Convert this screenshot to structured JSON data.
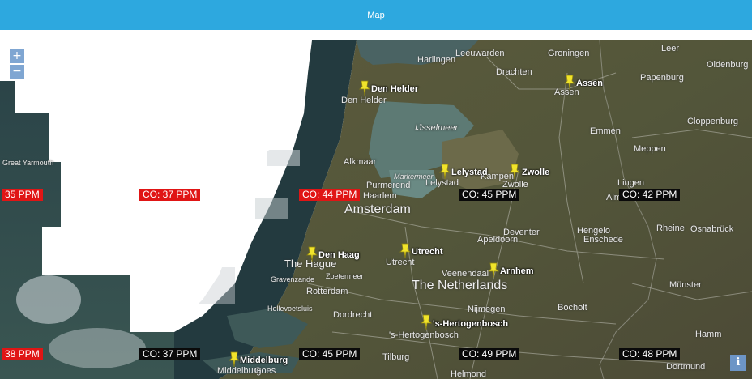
{
  "header": {
    "title": "Map"
  },
  "controls": {
    "zoom_in": "+",
    "zoom_out": "−",
    "info": "i"
  },
  "co_badges": [
    {
      "text": "35 PPM",
      "color": "red"
    },
    {
      "text": "CO: 37 PPM",
      "color": "red"
    },
    {
      "text": "CO: 44 PPM",
      "color": "red"
    },
    {
      "text": "CO: 45 PPM",
      "color": "black"
    },
    {
      "text": "CO: 42 PPM",
      "color": "black"
    },
    {
      "text": "38 PPM",
      "color": "red"
    },
    {
      "text": "CO: 37 PPM",
      "color": "black"
    },
    {
      "text": "CO: 45 PPM",
      "color": "black"
    },
    {
      "text": "CO: 49 PPM",
      "color": "black"
    },
    {
      "text": "CO: 48 PPM",
      "color": "black"
    }
  ],
  "city_markers": [
    "Den Helder",
    "Assen",
    "Lelystad",
    "Zwolle",
    "Den Haag",
    "Utrecht",
    "Arnhem",
    "'s-Hertogenbosch",
    "Middelburg"
  ],
  "basemap_labels": [
    "Leeuwarden",
    "Groningen",
    "Harlingen",
    "Drachten",
    "Den Helder",
    "Assen",
    "Alkmaar",
    "Amsterdam",
    "Haarlem",
    "Purmerend",
    "Lelystad",
    "Kampen",
    "Zwolle",
    "Emmen",
    "Meppen",
    "Lingen",
    "Almelo",
    "Deventer",
    "Hengelo",
    "Enschede",
    "Apeldoorn",
    "The Hague",
    "Utrecht",
    "Rotterdam",
    "The Netherlands",
    "Veenendaal",
    "Dordrecht",
    "Nijmegen",
    "Bocholt",
    "'s-Hertogenbosch",
    "Tilburg",
    "Hamm",
    "Dortmund",
    "Helmond",
    "Münster",
    "Osnabrück",
    "Papenburg",
    "Oldenburg",
    "Cloppenburg",
    "IJsselmeer",
    "Markermeer",
    "Rheine",
    "Middelburg",
    "Goes",
    "Great Yarmouth",
    "Zoetermeer",
    "Hellevoetsluis",
    "Gravenzande",
    "Leer"
  ]
}
